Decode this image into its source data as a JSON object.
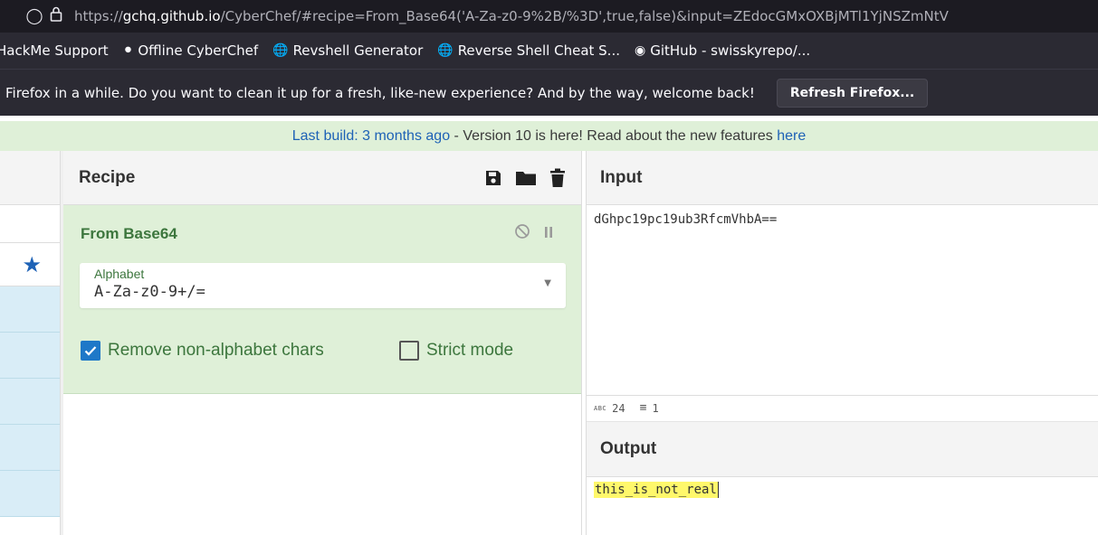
{
  "browser": {
    "url_prefix": "https://",
    "url_host": "gchq.github.io",
    "url_rest": "/CyberChef/#recipe=From_Base64('A-Za-z0-9%2B/%3D',true,false)&input=ZEdocGMxOXBjMTl1YjNSZmNtV",
    "bookmarks": [
      {
        "label": "HackMe Support",
        "icon": "none"
      },
      {
        "label": "Offline CyberChef",
        "icon": "chef-hat-icon"
      },
      {
        "label": "Revshell Generator",
        "icon": "globe-icon"
      },
      {
        "label": "Reverse Shell Cheat S...",
        "icon": "globe-icon"
      },
      {
        "label": "GitHub - swisskyrepo/...",
        "icon": "github-icon"
      }
    ],
    "notification": "Firefox in a while. Do you want to clean it up for a fresh, like-new experience? And by the way, welcome back!",
    "refresh_button": "Refresh Firefox..."
  },
  "banner": {
    "link1": "Last build: 3 months ago",
    "middle": " - Version 10 is here! Read about the new features ",
    "link2": "here"
  },
  "recipe": {
    "title": "Recipe",
    "operation": {
      "name": "From Base64",
      "alphabet_label": "Alphabet",
      "alphabet_value": "A-Za-z0-9+/=",
      "remove_label": "Remove non-alphabet chars",
      "remove_checked": true,
      "strict_label": "Strict mode",
      "strict_checked": false
    }
  },
  "input": {
    "title": "Input",
    "text": "dGhpc19pc19ub3RfcmVhbA==",
    "length": "24",
    "lines": "1"
  },
  "output": {
    "title": "Output",
    "text": "this_is_not_real"
  },
  "colors": {
    "accent_blue": "#1e62b6",
    "op_green_bg": "#dff0d8",
    "op_green_text": "#3c763d",
    "highlight": "#fff86b"
  }
}
